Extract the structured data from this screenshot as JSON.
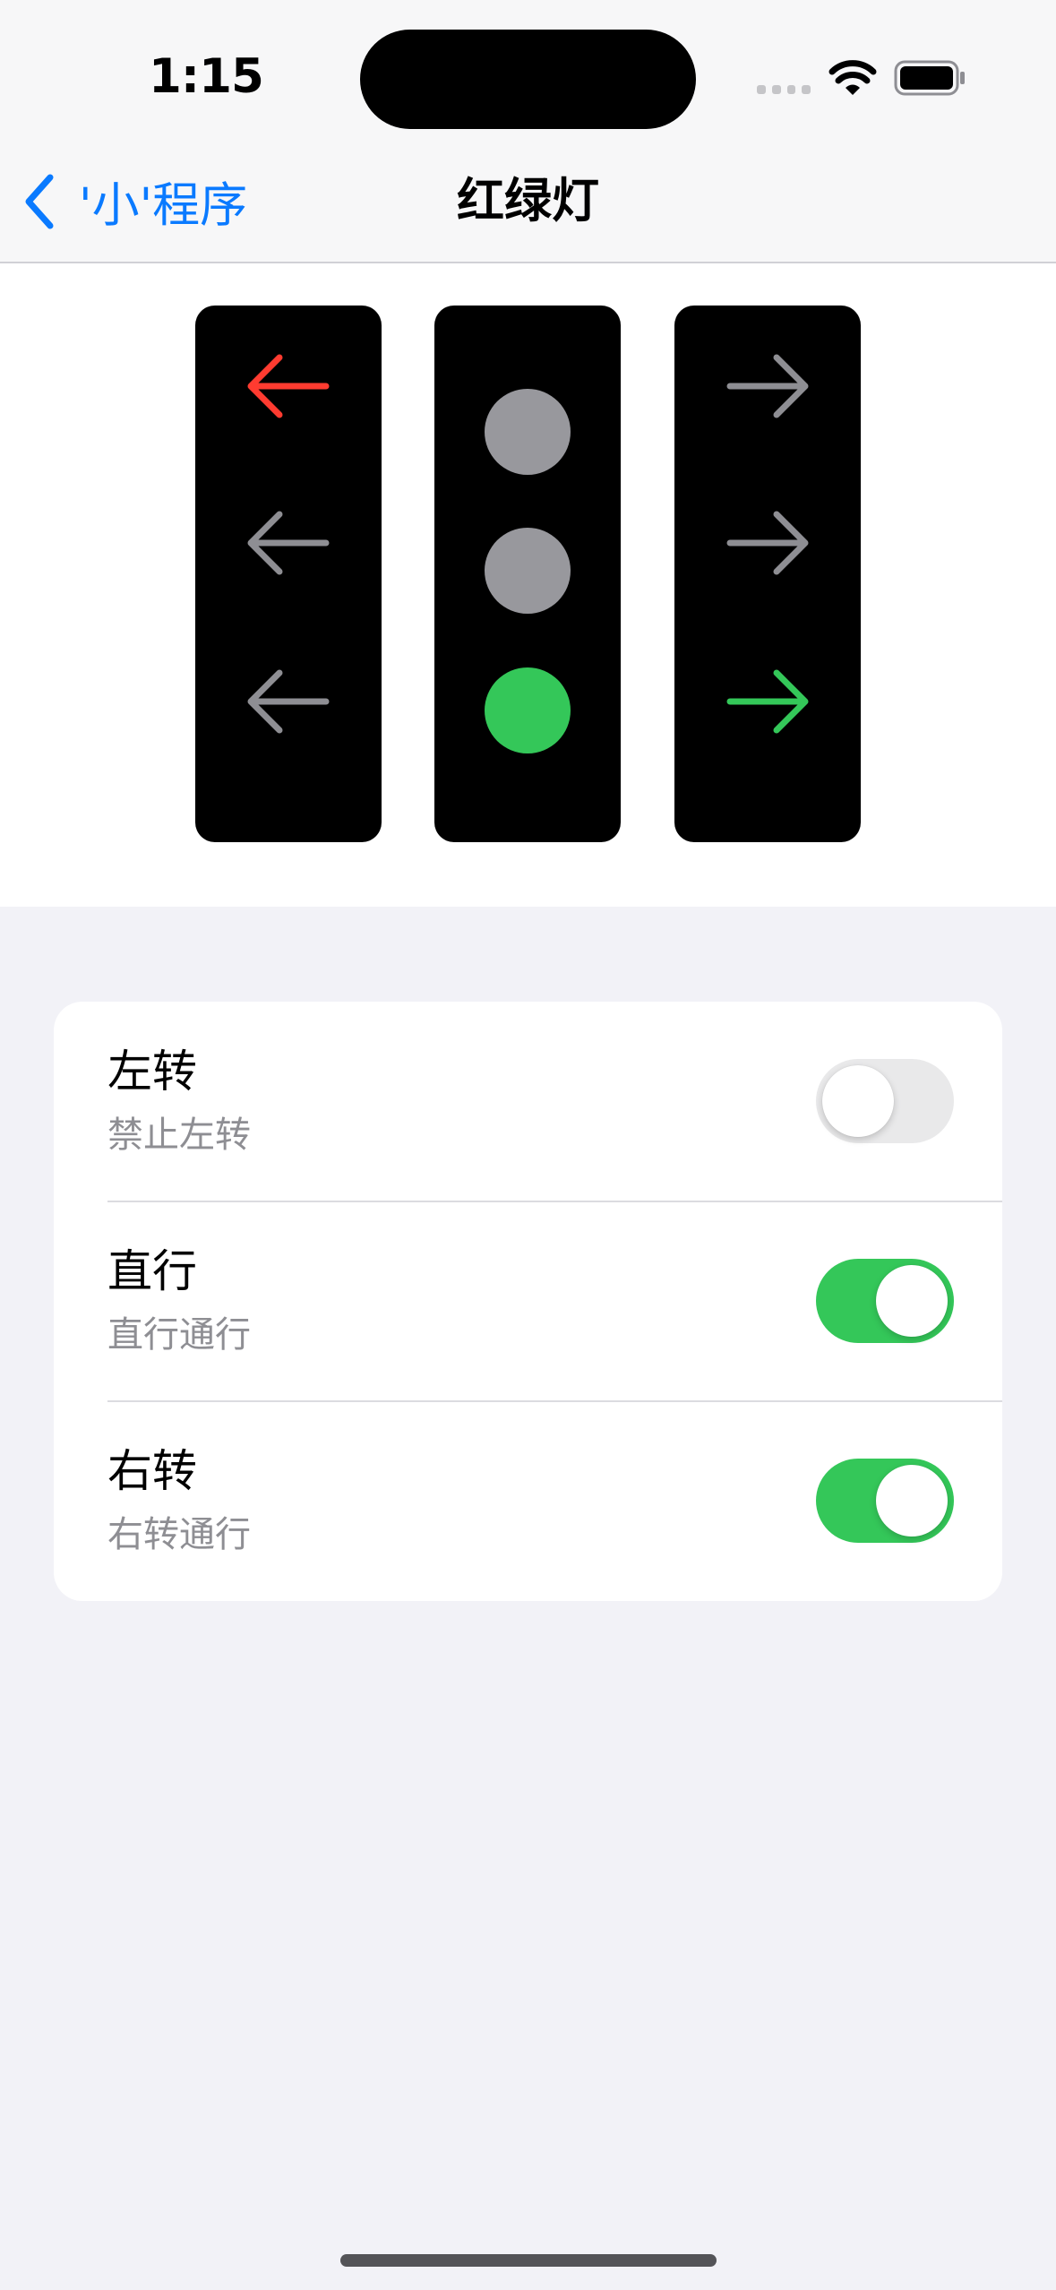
{
  "status_bar": {
    "time": "1:15"
  },
  "nav": {
    "back_label": "'小'程序",
    "title": "红绿灯"
  },
  "traffic_lights": {
    "colors": {
      "red": "#ff3b30",
      "green": "#34c759",
      "inactive_arrow": "#8e8e93",
      "inactive_lamp": "#98989d",
      "housing": "#000000"
    },
    "left_turn_signal": [
      "red",
      "off",
      "off"
    ],
    "straight_signal": [
      "off",
      "off",
      "green"
    ],
    "right_turn_signal": [
      "off",
      "off",
      "green"
    ]
  },
  "settings": {
    "rows": [
      {
        "title": "左转",
        "subtitle": "禁止左转",
        "enabled": false
      },
      {
        "title": "直行",
        "subtitle": "直行通行",
        "enabled": true
      },
      {
        "title": "右转",
        "subtitle": "右转通行",
        "enabled": true
      }
    ]
  },
  "icons": {
    "back": "chevron-left-icon",
    "wifi": "wifi-icon",
    "battery": "battery-icon",
    "signal": "cellular-signal-icon",
    "left_arrow": "arrow-left-icon",
    "right_arrow": "arrow-right-icon"
  }
}
